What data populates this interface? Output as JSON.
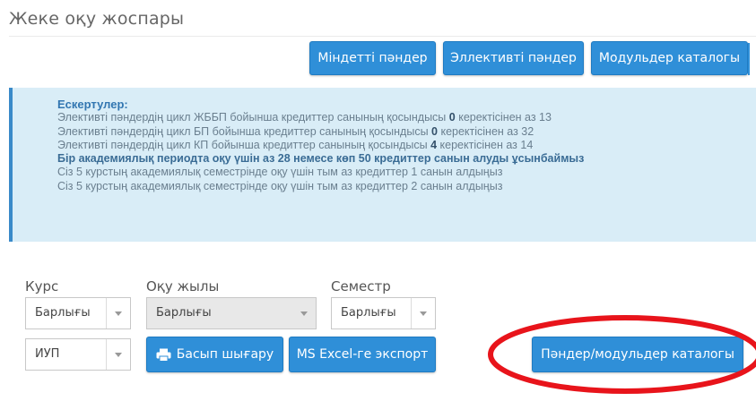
{
  "page": {
    "title": "Жеке оқу жоспары"
  },
  "toolbar": {
    "required_label": "Міндетті пәндер",
    "elective_label": "Эллективті пәндер",
    "modules_label": "Модульдер каталогы"
  },
  "notes": {
    "title": "Ескертулер:",
    "line1_pre": "Элективті пәндердің цикл ЖББП бойынша кредиттер санының қосындысы ",
    "line1_num": "0",
    "line1_post": " керектісінен аз 13",
    "line2_pre": "Элективті пәндердің цикл БП бойынша кредиттер санының қосындысы ",
    "line2_num": "0",
    "line2_post": " керектісінен аз 32",
    "line3_pre": "Элективті пәндердің цикл КП бойынша кредиттер санының қосындысы ",
    "line3_num": "4",
    "line3_post": " керектісінен аз 14",
    "line4": "Бір академиялық периодта оқу үшін аз 28 немесе көп 50 кредиттер санын алуды ұсынбаймыз",
    "line5": "Сіз 5 курстың академиялық семестрінде оқу үшін тым аз кредиттер 1 санын алдыңыз",
    "line6": "Сіз 5 курстың академиялық семестрінде оқу үшін тым аз кредиттер 2 санын алдыңыз"
  },
  "filters": {
    "course_label": "Курс",
    "course_value": "Барлығы",
    "year_label": "Оқу жылы",
    "year_value": "Барлығы",
    "semester_label": "Семестр",
    "semester_value": "Барлығы",
    "plan_value": "ИУП"
  },
  "actions": {
    "print_label": "Басып шығару",
    "excel_label": "MS Excel-ге экспорт",
    "catalog_label": "Пәндер/модульдер каталогы"
  },
  "colors": {
    "accent": "#2f8fd8",
    "notes_bg": "#d9edf7",
    "highlight": "#e8141b"
  }
}
